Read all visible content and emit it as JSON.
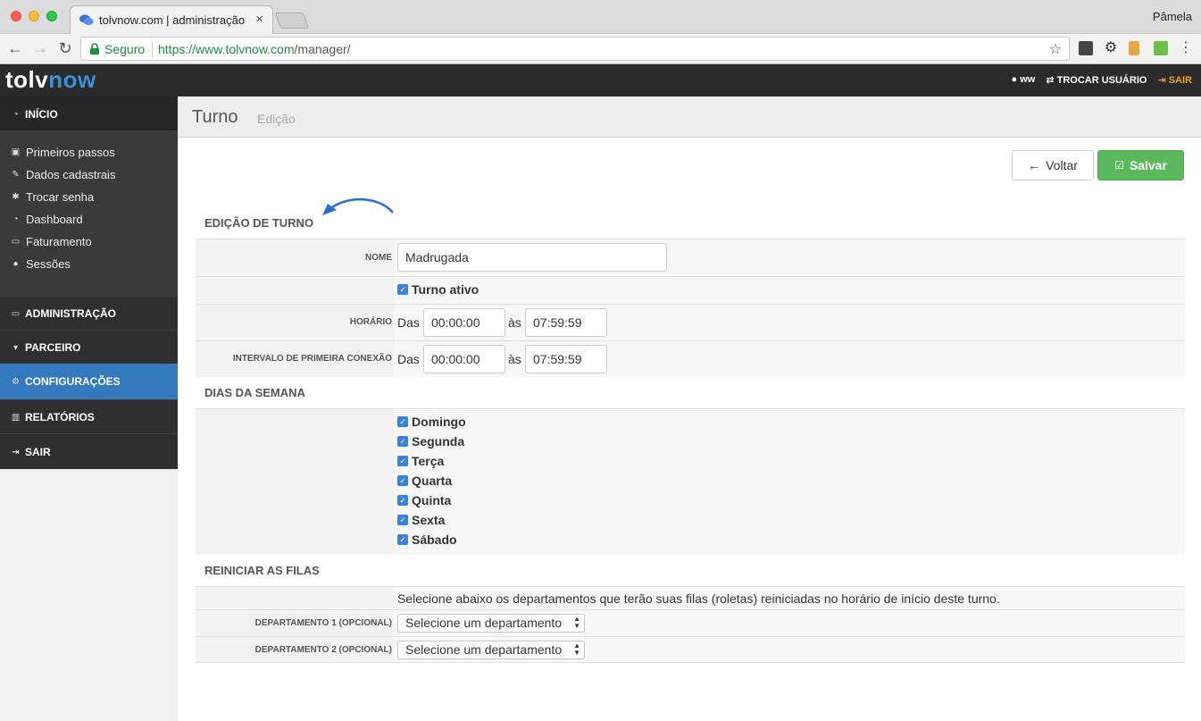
{
  "browser": {
    "tab_title": "tolvnow.com | administração",
    "profile": "Pâmela",
    "secure_label": "Seguro",
    "url_host": "https://www.tolvnow.com",
    "url_path": "/manager/"
  },
  "header": {
    "logo_a": "tolv",
    "logo_b": "now",
    "user": "ww",
    "switch_user": "TROCAR USUÁRIO",
    "logout": "SAIR"
  },
  "sidebar": {
    "home": "INÍCIO",
    "items": [
      {
        "label": "Primeiros passos",
        "icon": "briefcase-icon"
      },
      {
        "label": "Dados cadastrais",
        "icon": "edit-icon"
      },
      {
        "label": "Trocar senha",
        "icon": "asterisk-icon"
      },
      {
        "label": "Dashboard",
        "icon": "dashboard-icon"
      },
      {
        "label": "Faturamento",
        "icon": "money-icon"
      },
      {
        "label": "Sessões",
        "icon": "user-icon"
      }
    ],
    "sections": [
      {
        "label": "ADMINISTRAÇÃO",
        "icon": "monitor-icon"
      },
      {
        "label": "PARCEIRO",
        "icon": "cart-icon"
      },
      {
        "label": "CONFIGURAÇÕES",
        "icon": "cogs-icon"
      },
      {
        "label": "RELATÓRIOS",
        "icon": "chart-icon"
      },
      {
        "label": "SAIR",
        "icon": "signout-icon"
      }
    ],
    "active_color": "#3479bd"
  },
  "page": {
    "title": "Turno",
    "subtitle": "Edição",
    "back_label": "Voltar",
    "save_label": "Salvar"
  },
  "form": {
    "section_edit": "EDIÇÃO DE TURNO",
    "name_label": "NOME",
    "name_value": "Madrugada",
    "active_label": "Turno ativo",
    "hours_label": "HORÁRIO",
    "from_word": "Das",
    "to_word": "às",
    "hours_from": "00:00:00",
    "hours_to": "07:59:59",
    "interval_label": "INTERVALO DE PRIMEIRA CONEXÃO",
    "interval_from": "00:00:00",
    "interval_to": "07:59:59",
    "section_days": "DIAS DA SEMANA",
    "days": [
      "Domingo",
      "Segunda",
      "Terça",
      "Quarta",
      "Quinta",
      "Sexta",
      "Sábado"
    ],
    "section_reset": "REINICIAR AS FILAS",
    "reset_hint": "Selecione abaixo os departamentos que terão suas filas (roletas) reiniciadas no horário de início deste turno.",
    "dept1_label": "DEPARTAMENTO 1 (OPCIONAL)",
    "dept2_label": "DEPARTAMENTO 2 (OPCIONAL)",
    "dept_placeholder": "Selecione um departamento"
  }
}
